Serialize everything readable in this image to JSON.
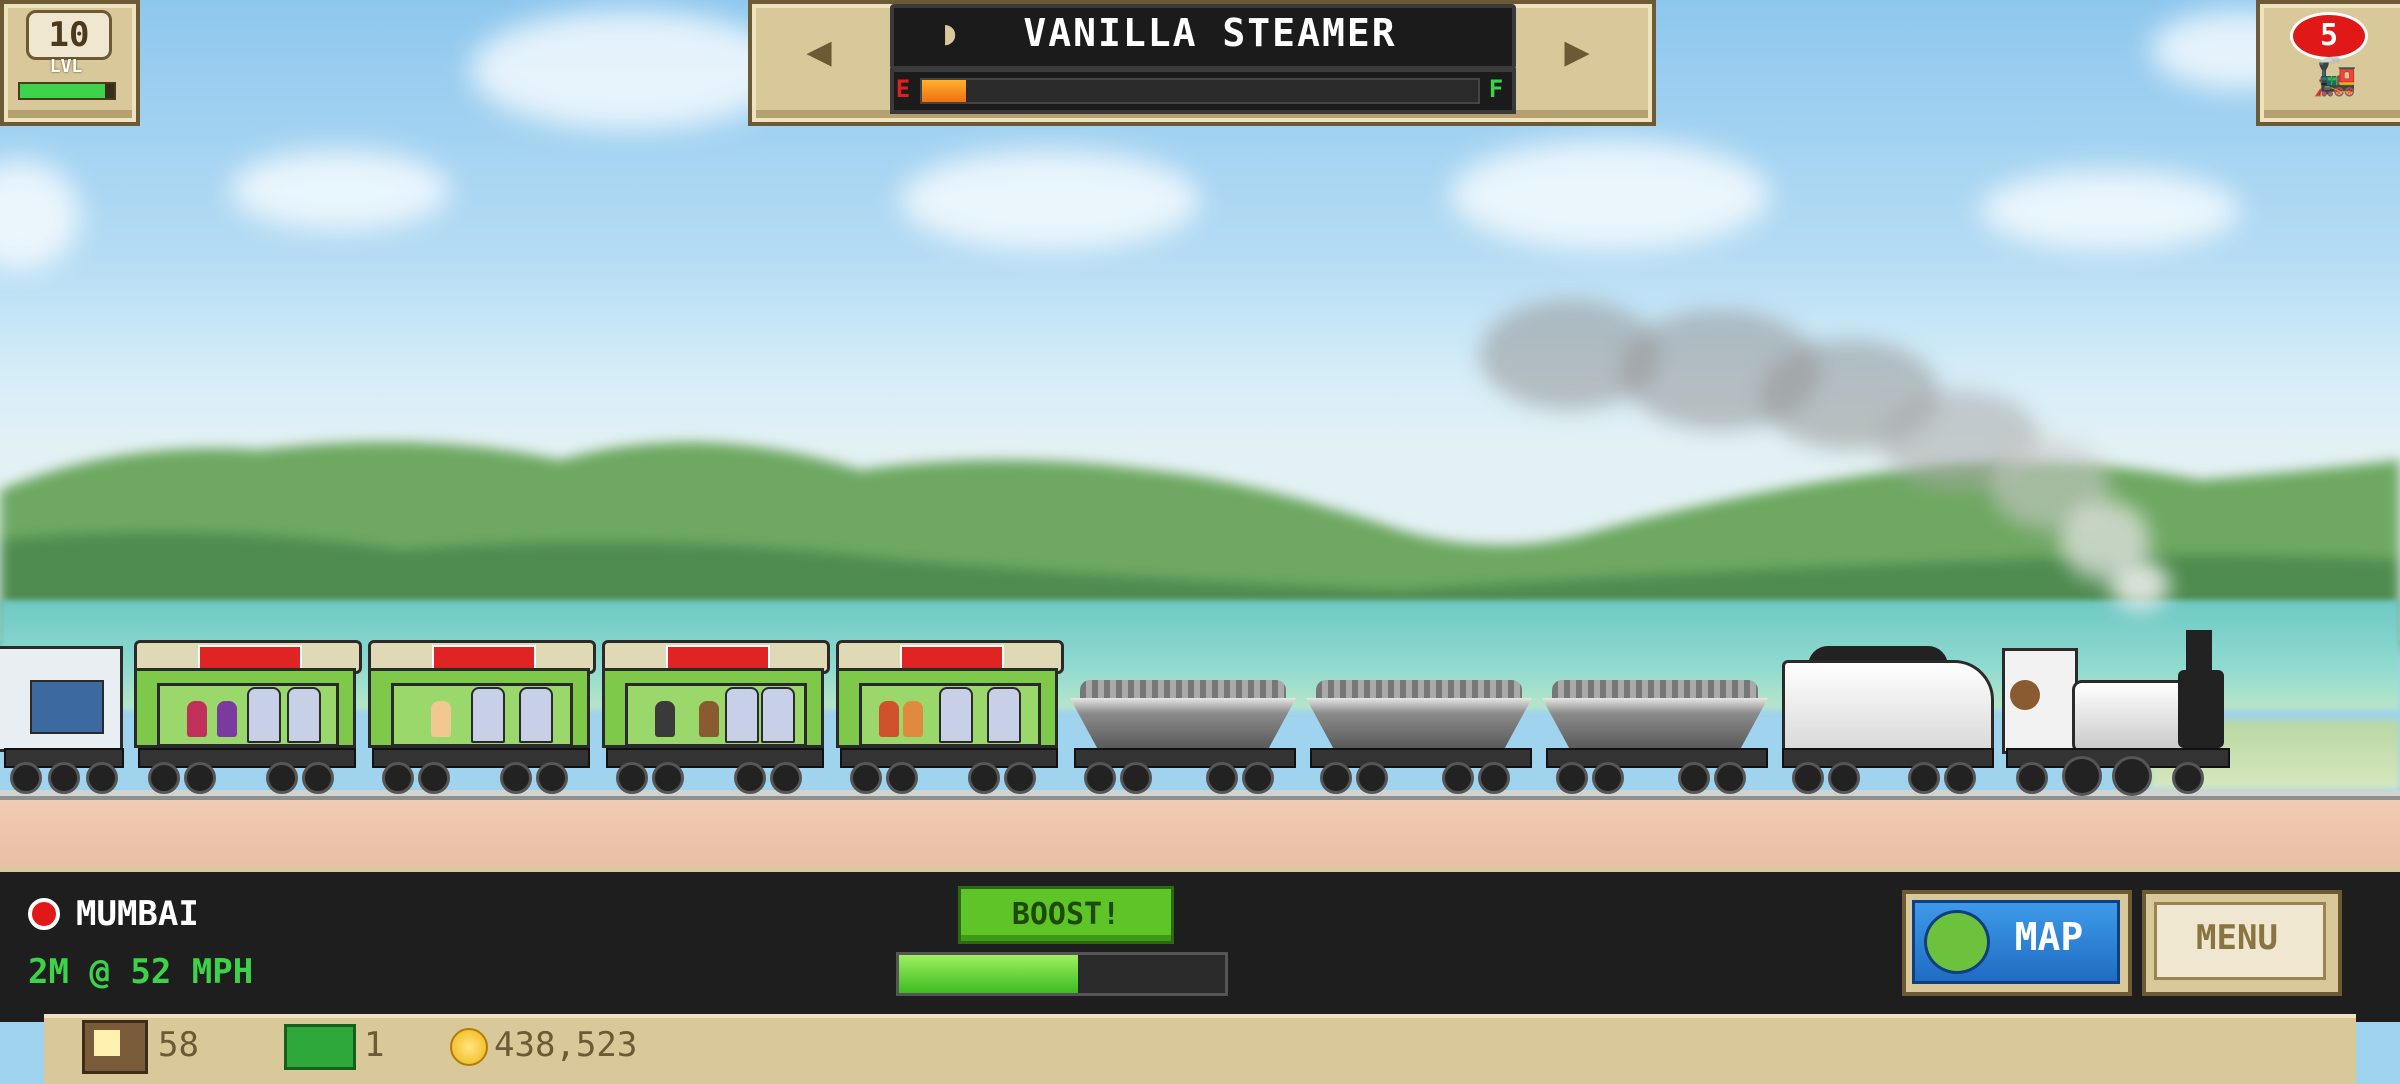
{
  "hud": {
    "level": {
      "value": "10",
      "label": "LVL",
      "xp_progress": 0.9
    },
    "train": {
      "name": "VANILLA STEAMER",
      "fuel_empty_label": "E",
      "fuel_full_label": "F",
      "fuel_level": 0.08
    },
    "trains_owned": {
      "count": "5"
    }
  },
  "status": {
    "station": "MUMBAI",
    "distance_speed": "2M @ 52 MPH",
    "boost_label": "BOOST!",
    "boost_progress": 0.55
  },
  "buttons": {
    "map_label": "MAP",
    "menu_label": "MENU"
  },
  "currency": {
    "crates": "58",
    "cash": "1",
    "coins": "438,523"
  },
  "icons": [
    "level-badge-icon",
    "prev-train-arrow-icon",
    "next-train-arrow-icon",
    "train-icon",
    "train-count-icon",
    "station-marker-icon",
    "map-icon",
    "crate-icon",
    "cash-icon",
    "coin-icon"
  ],
  "colors": {
    "panel": "#d9c89a",
    "accent_green": "#3cd24a",
    "boost_green": "#5ec428",
    "map_blue": "#1f6cc4",
    "alert_red": "#e01818"
  }
}
